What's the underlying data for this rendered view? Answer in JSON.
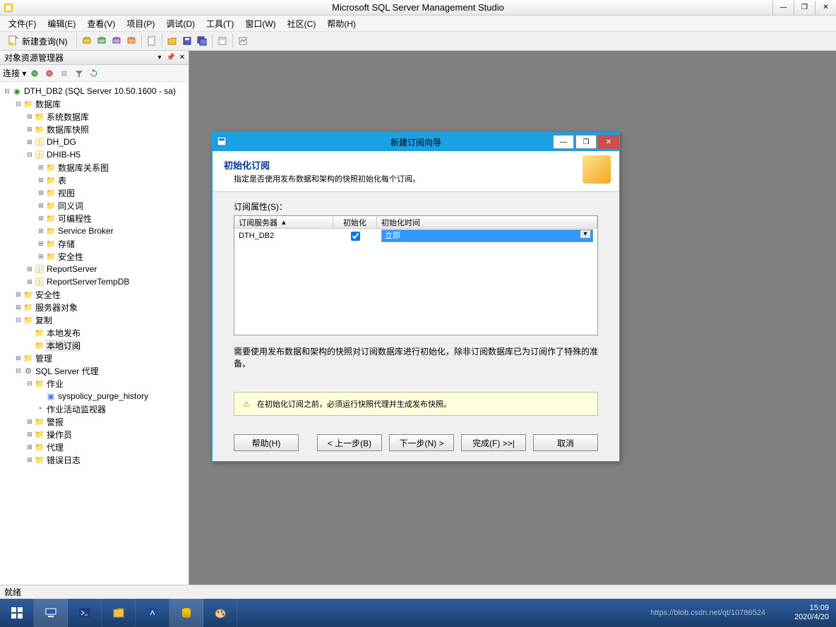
{
  "titlebar": {
    "title": "Microsoft SQL Server Management Studio"
  },
  "menu": {
    "file": "文件(F)",
    "edit": "编辑(E)",
    "view": "查看(V)",
    "project": "项目(P)",
    "debug": "调试(D)",
    "tools": "工具(T)",
    "window": "窗口(W)",
    "community": "社区(C)",
    "help": "帮助(H)"
  },
  "toolbar": {
    "new_query": "新建查询(N)"
  },
  "explorer": {
    "title": "对象资源管理器",
    "connect_label": "连接 ▾",
    "root": "DTH_DB2 (SQL Server 10.50.1600 - sa)",
    "databases": "数据库",
    "sys_db": "系统数据库",
    "db_snapshot": "数据库快照",
    "dh_dg": "DH_DG",
    "dhib_h5": "DHIB-H5",
    "diagrams": "数据库关系图",
    "tables": "表",
    "views": "视图",
    "synonyms": "同义词",
    "programmability": "可编程性",
    "service_broker": "Service Broker",
    "storage": "存储",
    "security_db": "安全性",
    "report_server": "ReportServer",
    "report_server_temp": "ReportServerTempDB",
    "security": "安全性",
    "server_objects": "服务器对象",
    "replication": "复制",
    "local_pub": "本地发布",
    "local_sub": "本地订阅",
    "management": "管理",
    "sql_agent": "SQL Server 代理",
    "jobs": "作业",
    "syspolicy": "syspolicy_purge_history",
    "activity_monitor": "作业活动监视器",
    "alerts": "警报",
    "operators": "操作员",
    "proxies": "代理",
    "error_logs": "错误日志"
  },
  "dialog": {
    "title": "新建订阅向导",
    "heading": "初始化订阅",
    "subtitle": "指定是否使用发布数据和架构的快照初始化每个订阅。",
    "grid_label": "订阅属性(S)：",
    "col_server": "订阅服务器",
    "col_init": "初始化",
    "col_init_time": "初始化时间",
    "row_server": "DTH_DB2",
    "row_init_time": "立即",
    "note": "需要使用发布数据和架构的快照对订阅数据库进行初始化，除非订阅数据库已为订阅作了特殊的准备。",
    "warning": "在初始化订阅之前，必须运行快照代理并生成发布快照。",
    "btn_help": "帮助(H)",
    "btn_back": "< 上一步(B)",
    "btn_next": "下一步(N) >",
    "btn_finish": "完成(F) >>|",
    "btn_cancel": "取消"
  },
  "status": {
    "ready": "就绪"
  },
  "taskbar": {
    "url": "https://blob.csdn.net/qt/10786524",
    "time": "15:09",
    "date": "2020/4/20"
  }
}
